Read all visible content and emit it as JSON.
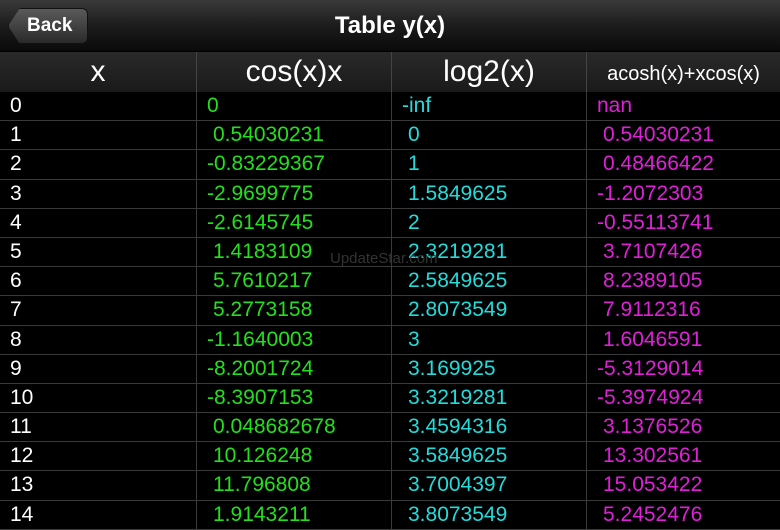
{
  "nav": {
    "back": "Back",
    "title": "Table y(x)"
  },
  "headers": [
    "x",
    "cos(x)x",
    "log2(x)",
    "acosh(x)+xcos(x)"
  ],
  "watermark": "UpdateStar.com",
  "colors": {
    "x": "#ffffff",
    "col1": "#22e01c",
    "col2": "#22dcdc",
    "col3": "#e020d8"
  },
  "rows": [
    [
      "0",
      "0",
      "-inf",
      "nan"
    ],
    [
      "1",
      "0.54030231",
      "0",
      "0.54030231"
    ],
    [
      "2",
      "-0.83229367",
      "1",
      "0.48466422"
    ],
    [
      "3",
      "-2.9699775",
      "1.5849625",
      "-1.2072303"
    ],
    [
      "4",
      "-2.6145745",
      "2",
      "-0.55113741"
    ],
    [
      "5",
      "1.4183109",
      "2.3219281",
      "3.7107426"
    ],
    [
      "6",
      "5.7610217",
      "2.5849625",
      "8.2389105"
    ],
    [
      "7",
      "5.2773158",
      "2.8073549",
      "7.9112316"
    ],
    [
      "8",
      "-1.1640003",
      "3",
      "1.6046591"
    ],
    [
      "9",
      "-8.2001724",
      "3.169925",
      "-5.3129014"
    ],
    [
      "10",
      "-8.3907153",
      "3.3219281",
      "-5.3974924"
    ],
    [
      "11",
      "0.048682678",
      "3.4594316",
      "3.1376526"
    ],
    [
      "12",
      "10.126248",
      "3.5849625",
      "13.302561"
    ],
    [
      "13",
      "11.796808",
      "3.7004397",
      "15.053422"
    ],
    [
      "14",
      "1.9143211",
      "3.8073549",
      "5.2452476"
    ]
  ]
}
